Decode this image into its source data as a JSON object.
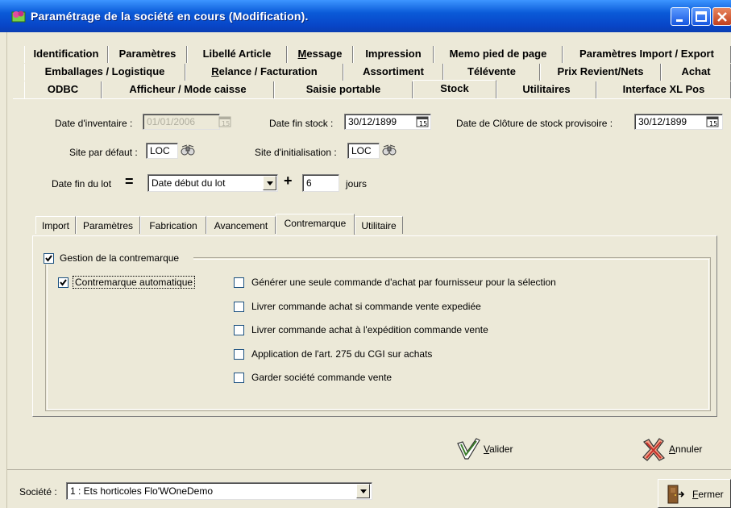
{
  "window": {
    "title": "Paramétrage de la société en cours (Modification).",
    "title_color": "#0a5ad8"
  },
  "tabs": {
    "row1": [
      "Identification",
      "Paramètres",
      "Libellé Article",
      "Message",
      "Impression",
      "Memo pied de page",
      "Paramètres Import / Export"
    ],
    "row2": [
      "Emballages / Logistique",
      "Relance / Facturation",
      "Assortiment",
      "Télévente",
      "Prix Revient/Nets",
      "Achat"
    ],
    "row3": [
      "ODBC",
      "Afficheur / Mode caisse",
      "Saisie portable",
      "Stock",
      "Utilitaires",
      "Interface XL Pos"
    ],
    "active": "Stock"
  },
  "stock": {
    "date_inventaire_label": "Date d'inventaire :",
    "date_inventaire_value": "01/01/2006",
    "date_fin_stock_label": "Date fin stock :",
    "date_fin_stock_value": "30/12/1899",
    "date_cloture_label": "Date de Clôture de stock provisoire :",
    "date_cloture_value": "30/12/1899",
    "site_defaut_label": "Site par défaut :",
    "site_defaut_value": "LOC",
    "site_init_label": "Site d'initialisation :",
    "site_init_value": "LOC",
    "date_fin_lot_label": "Date fin du lot",
    "equals": "=",
    "date_debut_lot_value": "Date début du lot",
    "plus": "+",
    "jours_value": "6",
    "jours_label": "jours"
  },
  "subtabs": {
    "items": [
      "Import",
      "Paramètres",
      "Fabrication",
      "Avancement",
      "Contremarque",
      "Utilitaire"
    ],
    "active": "Contremarque"
  },
  "contremarque": {
    "group_label": "Gestion de la contremarque",
    "group_checked": true,
    "auto_label": "Contremarque automatique",
    "auto_checked": true,
    "options": [
      {
        "label": "Générer une seule commande d'achat par fournisseur pour la sélection",
        "checked": false
      },
      {
        "label": "Livrer commande achat si commande vente expediée",
        "checked": false
      },
      {
        "label": "Livrer commande achat à l'expédition commande vente",
        "checked": false
      },
      {
        "label": "Application de l'art. 275 du CGI sur achats",
        "checked": false
      },
      {
        "label": "Garder société commande vente",
        "checked": false
      }
    ]
  },
  "buttons": {
    "valider": "Valider",
    "annuler": "Annuler",
    "fermer": "Fermer"
  },
  "footer": {
    "societe_label": "Société :",
    "societe_value": "1 : Ets horticoles Flo'WOneDemo"
  },
  "icons": {
    "app": "app-icon",
    "calendar": "calendar-icon",
    "binoculars": "binoculars-icon",
    "valider": "check-icon",
    "annuler": "cancel-icon",
    "fermer": "door-exit-icon"
  }
}
